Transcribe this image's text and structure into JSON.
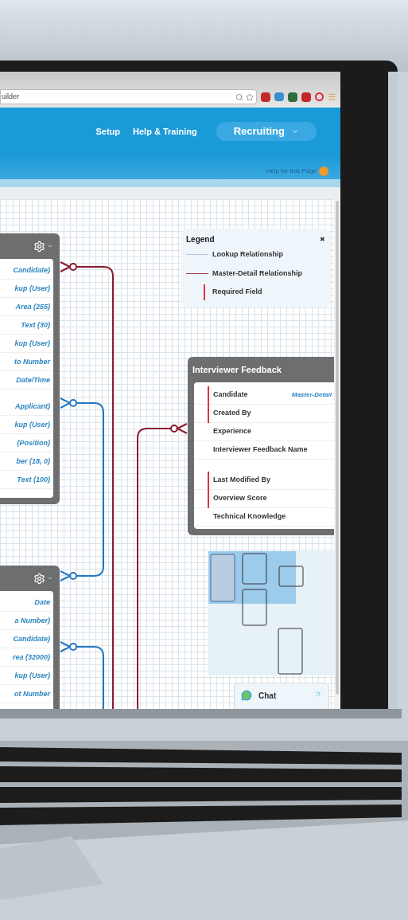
{
  "browser": {
    "address": "uilder"
  },
  "header": {
    "links": [
      {
        "label": "Setup"
      },
      {
        "label": "Help & Training"
      }
    ],
    "app_menu": {
      "label": "Recruiting"
    }
  },
  "help_link": {
    "label": "Help for this Page"
  },
  "diagram": {
    "objects": [
      {
        "field_groups": [
          [
            "Candidate)",
            "kup (User)",
            "Area (255)",
            "Text (30)",
            "kup (User)",
            "to Number",
            "Date/Time"
          ],
          [
            "Applicant)",
            "kup (User)",
            "(Position)",
            "ber (18, 0)",
            "Text (100)"
          ]
        ]
      },
      {
        "field_groups": [
          [
            "Date",
            "a Number)",
            "Candidate)",
            "rea (32000)",
            "kup (User)",
            "ot Number"
          ]
        ]
      }
    ],
    "legend": {
      "title": "Legend",
      "close": "✖",
      "items": [
        {
          "kind": "lookup",
          "label": "Lookup Relationship"
        },
        {
          "kind": "master_detail",
          "label": "Master-Detail Relationship"
        },
        {
          "kind": "required",
          "label": "Required Field"
        }
      ]
    },
    "feedback_object": {
      "title": "Interviewer Feedback",
      "field_groups": [
        [
          {
            "name": "Candidate",
            "type": "Master-Detail",
            "required": true
          },
          {
            "name": "Created By",
            "required": true
          },
          {
            "name": "Experience",
            "required": false
          },
          {
            "name": "Interviewer Feedback Name",
            "required": false
          }
        ],
        [
          {
            "name": "Last Modified By",
            "required": true
          },
          {
            "name": "Overview Score",
            "required": true
          },
          {
            "name": "Technical Knowledge",
            "required": false
          }
        ]
      ]
    }
  },
  "chat": {
    "label": "Chat"
  }
}
